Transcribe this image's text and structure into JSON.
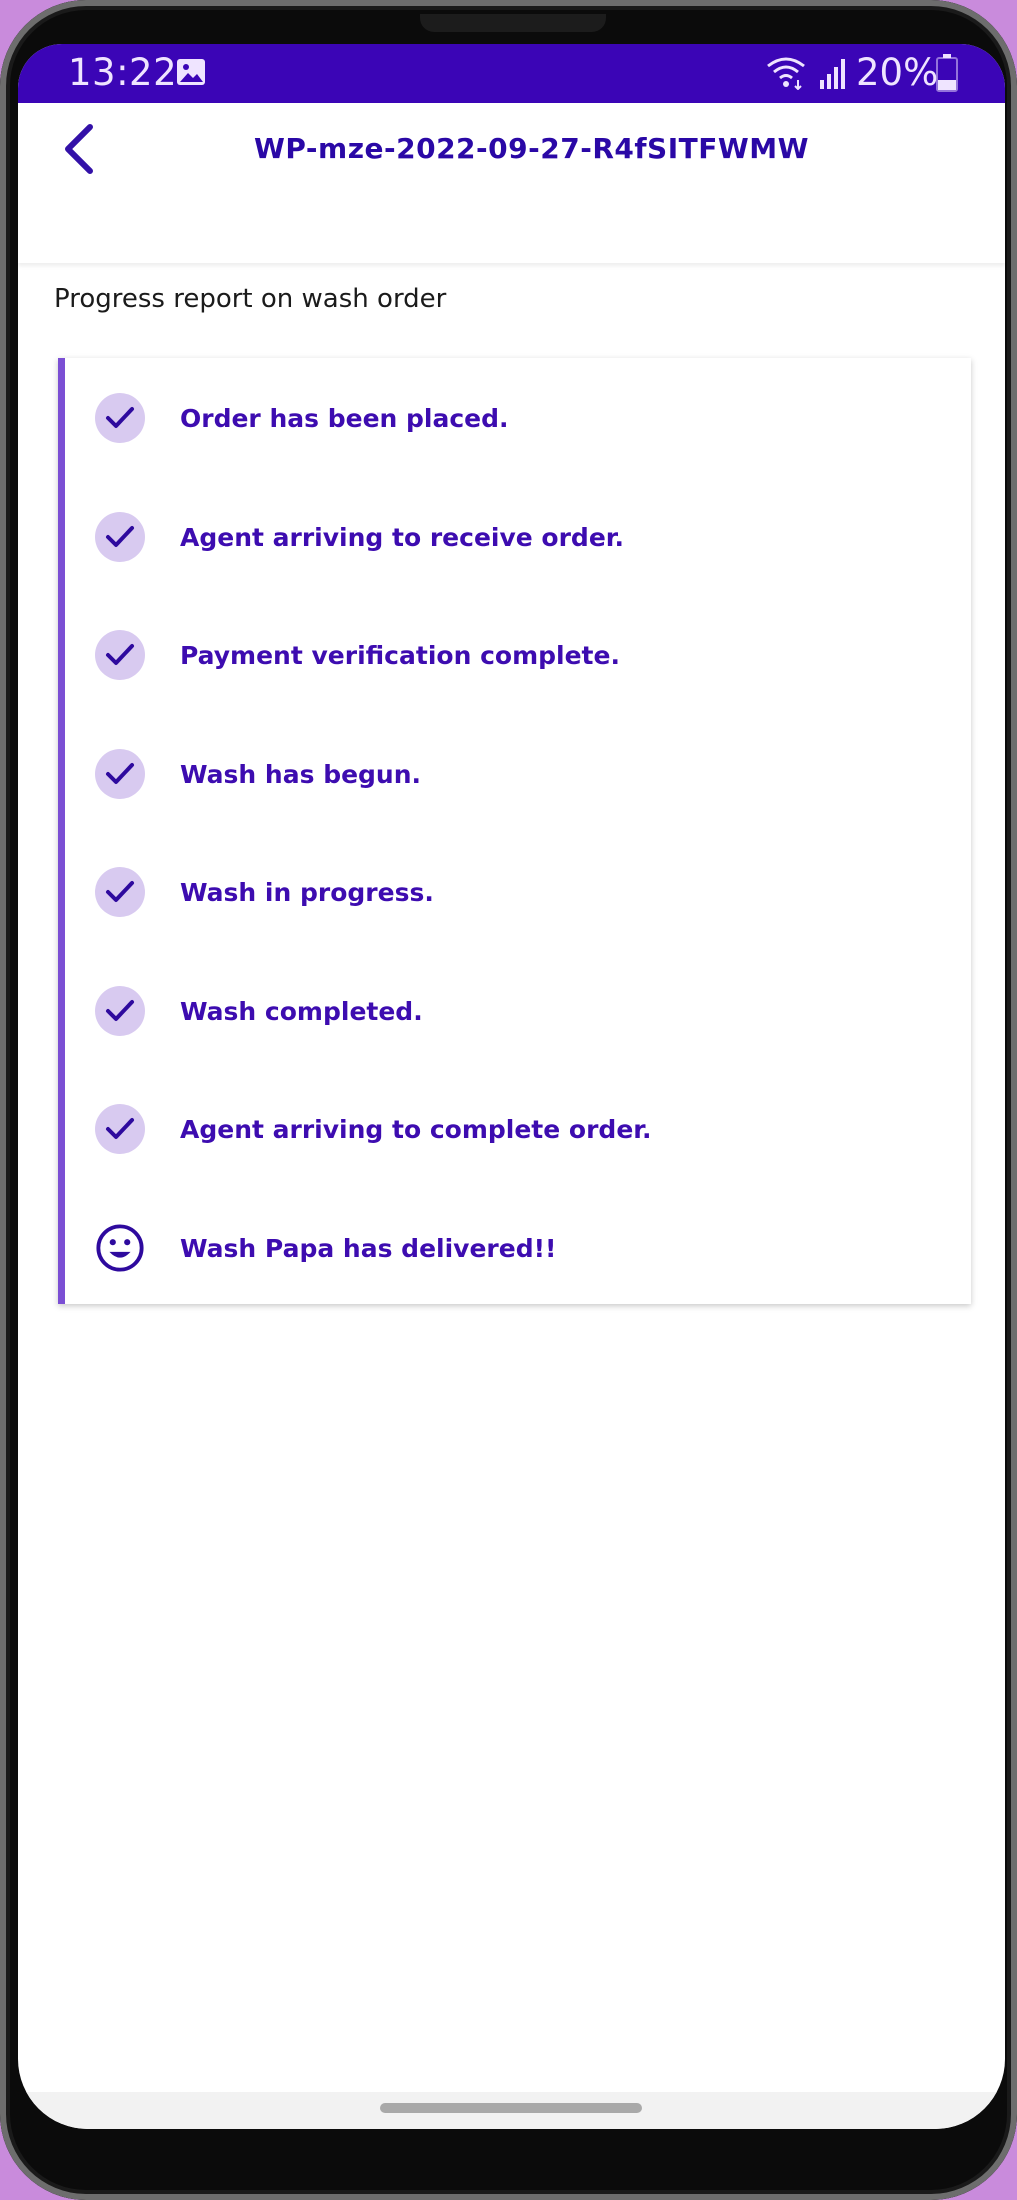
{
  "status_bar": {
    "time": "13:22",
    "battery_percent": "20%",
    "icons": [
      "gallery-icon",
      "wifi-icon",
      "signal-icon",
      "battery-icon"
    ]
  },
  "app_bar": {
    "title": "WP-mze-2022-09-27-R4fSITFWMW",
    "back_icon": "chevron-left-icon"
  },
  "subtitle": "Progress report on wash order",
  "steps": [
    {
      "label": "Order has been placed.",
      "icon": "check-icon",
      "done": true
    },
    {
      "label": "Agent arriving to receive order.",
      "icon": "check-icon",
      "done": true
    },
    {
      "label": "Payment verification complete.",
      "icon": "check-icon",
      "done": true
    },
    {
      "label": "Wash has begun.",
      "icon": "check-icon",
      "done": true
    },
    {
      "label": "Wash in progress.",
      "icon": "check-icon",
      "done": true
    },
    {
      "label": "Wash completed.",
      "icon": "check-icon",
      "done": true
    },
    {
      "label": "Agent arriving to complete order.",
      "icon": "check-icon",
      "done": true
    },
    {
      "label": "Wash Papa has delivered!!",
      "icon": "smiley-icon",
      "done": true
    }
  ],
  "colors": {
    "status_bar": "#3b05b6",
    "accent": "#3d0cb0",
    "timeline_line": "#7b4fd4",
    "check_circle": "#d8caf0"
  }
}
